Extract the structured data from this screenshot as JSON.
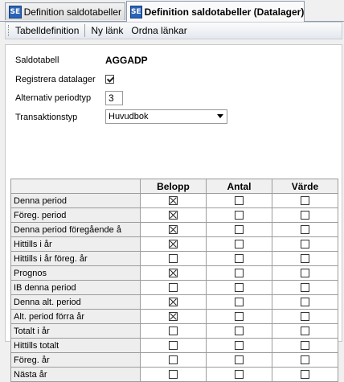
{
  "tabs": [
    {
      "icon": "SE",
      "label": "Definition saldotabeller"
    },
    {
      "icon": "SE",
      "label": "Definition saldotabeller (Datalager)"
    }
  ],
  "toolbar": {
    "tabelldefinition": "Tabelldefinition",
    "ny_lank": "Ny länk",
    "ordna_lankar": "Ordna länkar"
  },
  "form": {
    "saldotabell_label": "Saldotabell",
    "saldotabell_value": "AGGADP",
    "registrera_label": "Registrera datalager",
    "registrera_checked": true,
    "alt_periodtyp_label": "Alternativ periodtyp",
    "alt_periodtyp_value": "3",
    "transaktionstyp_label": "Transaktionstyp",
    "transaktionstyp_value": "Huvudbok"
  },
  "grid": {
    "columns": [
      "Belopp",
      "Antal",
      "Värde"
    ],
    "rows": [
      {
        "label": "Denna period",
        "values": [
          true,
          false,
          false
        ]
      },
      {
        "label": "Föreg. period",
        "values": [
          true,
          false,
          false
        ]
      },
      {
        "label": "Denna period föregående å",
        "values": [
          true,
          false,
          false
        ]
      },
      {
        "label": "Hittills i år",
        "values": [
          true,
          false,
          false
        ]
      },
      {
        "label": "Hittills i år föreg. år",
        "values": [
          false,
          false,
          false
        ]
      },
      {
        "label": "Prognos",
        "values": [
          true,
          false,
          false
        ]
      },
      {
        "label": "IB denna period",
        "values": [
          false,
          false,
          false
        ]
      },
      {
        "label": "Denna alt. period",
        "values": [
          true,
          false,
          false
        ]
      },
      {
        "label": "Alt. period förra år",
        "values": [
          true,
          false,
          false
        ]
      },
      {
        "label": "Totalt i år",
        "values": [
          false,
          false,
          false
        ]
      },
      {
        "label": "Hittills totalt",
        "values": [
          false,
          false,
          false
        ]
      },
      {
        "label": "Föreg. år",
        "values": [
          false,
          false,
          false
        ]
      },
      {
        "label": "Nästa år",
        "values": [
          false,
          false,
          false
        ]
      }
    ]
  }
}
